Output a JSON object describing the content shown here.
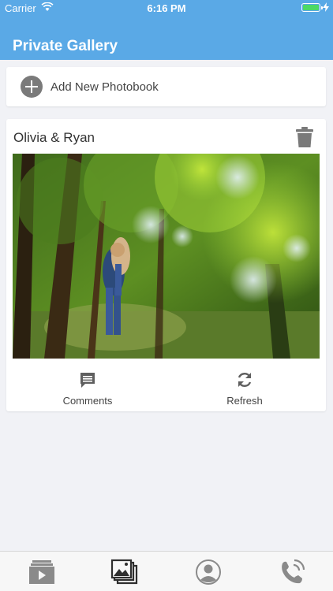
{
  "status_bar": {
    "carrier": "Carrier",
    "time": "6:16 PM"
  },
  "navbar": {
    "title": "Private Gallery"
  },
  "add_photobook": {
    "label": "Add New Photobook",
    "icon": "plus-circle-icon"
  },
  "album": {
    "title": "Olivia & Ryan",
    "delete_icon": "trash-icon",
    "actions": [
      {
        "label": "Comments",
        "icon": "comment-icon"
      },
      {
        "label": "Refresh",
        "icon": "refresh-icon"
      }
    ]
  },
  "tab_bar": {
    "tabs": [
      {
        "icon": "video-stack-icon",
        "active": false
      },
      {
        "icon": "photo-gallery-icon",
        "active": true
      },
      {
        "icon": "profile-icon",
        "active": false
      },
      {
        "icon": "phone-call-icon",
        "active": false
      }
    ]
  },
  "colors": {
    "header": "#5aa9e6",
    "background": "#f1f2f6",
    "icon_gray": "#7a7a7a"
  }
}
